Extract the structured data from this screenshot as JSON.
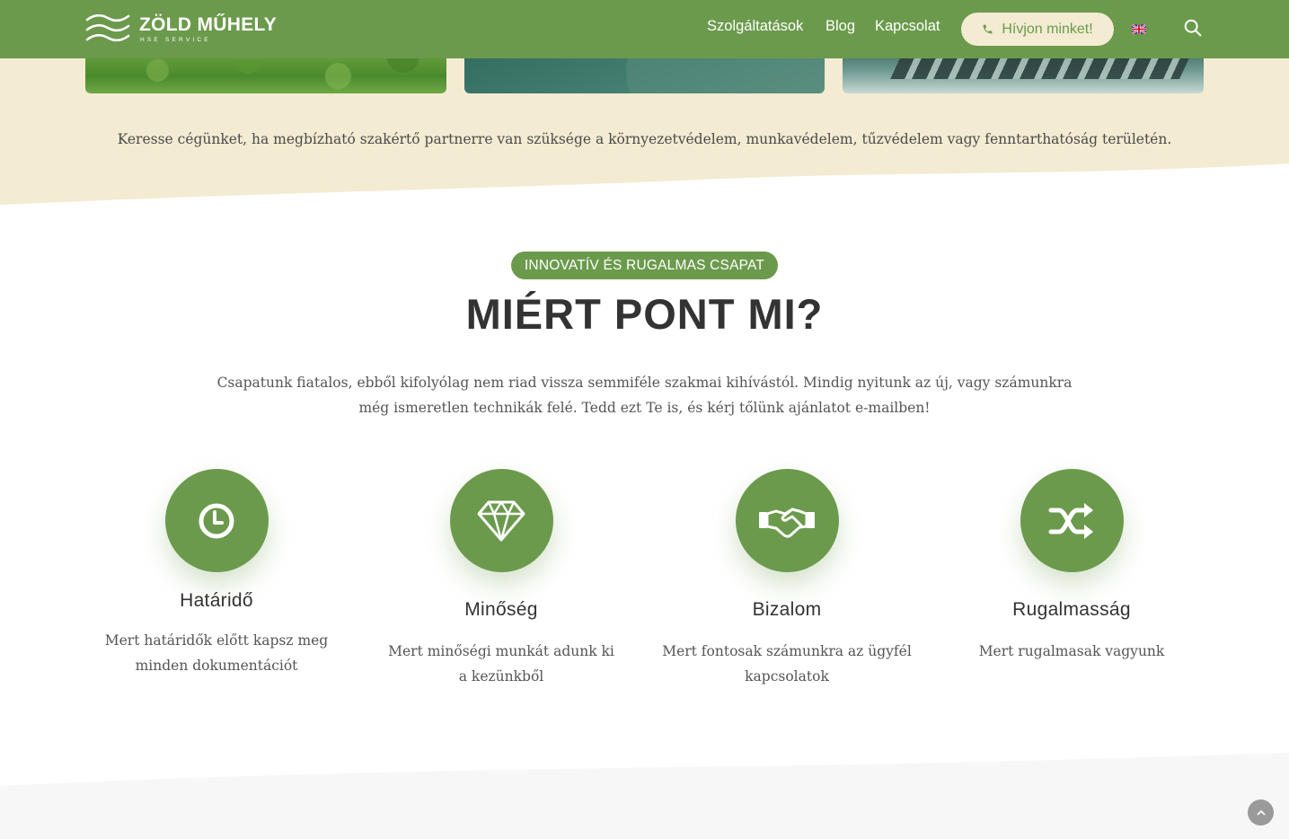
{
  "header": {
    "logo_title": "ZÖLD MŰHELY",
    "logo_subtitle": "HSE SERVICE",
    "nav": [
      "Szolgáltatások",
      "Blog",
      "Kapcsolat"
    ],
    "call_button": "Hívjon minket!",
    "language_icon": "uk-flag-icon",
    "search_icon": "search-icon"
  },
  "intro": {
    "text": "Keresse cégünket, ha megbízható szakértő partnerre van szüksége a környezetvédelem, munkavédelem, tűzvédelem vagy fenntarthatóság területén."
  },
  "why": {
    "tag": "INNOVATÍV ÉS RUGALMAS CSAPAT",
    "title": "MIÉRT PONT MI?",
    "description": "Csapatunk fiatalos, ebből kifolyólag nem riad vissza semmiféle szakmai kihívástól. Mindig nyitunk az új, vagy számunkra még ismeretlen technikák felé. Tedd ezt Te is, és kérj tőlünk ajánlatot e-mailben!",
    "features": [
      {
        "icon": "clock-icon",
        "title": "Határidő",
        "text": "Mert határidők előtt kapsz meg minden dokumentációt"
      },
      {
        "icon": "diamond-icon",
        "title": "Minőség",
        "text": "Mert minőségi munkát adunk ki a kezünkből"
      },
      {
        "icon": "handshake-icon",
        "title": "Bizalom",
        "text": "Mert fontosak számunkra az ügyfél kapcsolatok"
      },
      {
        "icon": "shuffle-icon",
        "title": "Rugalmasság",
        "text": "Mert rugalmasak vagyunk"
      }
    ]
  },
  "colors": {
    "brand_green": "#6b9a4c",
    "beige": "#f3ebd2",
    "text_dark": "#333333"
  }
}
